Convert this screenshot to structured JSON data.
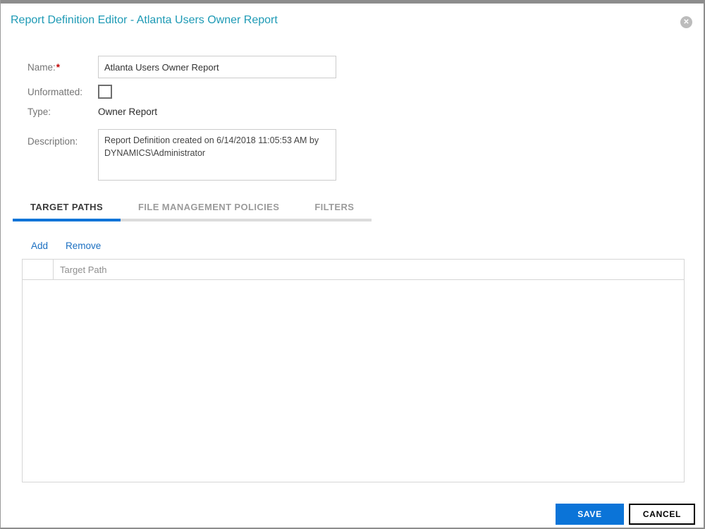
{
  "dialog": {
    "title": "Report Definition Editor - Atlanta Users Owner Report",
    "close_glyph": "✕"
  },
  "form": {
    "name": {
      "label": "Name:",
      "required_marker": "*",
      "value": "Atlanta Users Owner Report"
    },
    "unformatted": {
      "label": "Unformatted:",
      "checked": false
    },
    "type": {
      "label": "Type:",
      "value": "Owner Report"
    },
    "description": {
      "label": "Description:",
      "value": "Report Definition created on 6/14/2018 11:05:53 AM by DYNAMICS\\Administrator"
    }
  },
  "tabs": [
    {
      "label": "TARGET PATHS",
      "active": true
    },
    {
      "label": "FILE MANAGEMENT POLICIES",
      "active": false
    },
    {
      "label": "FILTERS",
      "active": false
    }
  ],
  "toolbar": {
    "add_label": "Add",
    "remove_label": "Remove"
  },
  "table": {
    "columns": [
      "",
      "Target Path"
    ],
    "rows": []
  },
  "footer": {
    "save_label": "SAVE",
    "cancel_label": "CANCEL"
  },
  "colors": {
    "accent_blue": "#0b74d8",
    "title_teal": "#1e9ab5",
    "link_blue": "#1b6fc1",
    "label_gray": "#757575"
  }
}
